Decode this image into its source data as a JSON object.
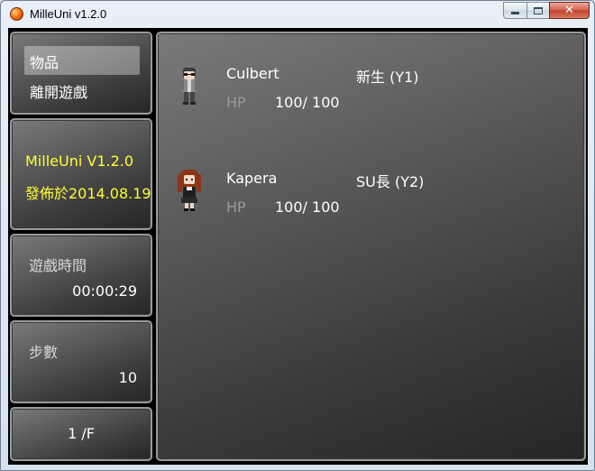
{
  "window": {
    "title": "MilleUni v1.2.0",
    "minimize_glyph": "minimize-icon",
    "maximize_glyph": "maximize-icon",
    "close_glyph": "✕"
  },
  "menu": {
    "items": [
      {
        "label": "物品",
        "selected": true
      },
      {
        "label": "離開遊戲",
        "selected": false
      }
    ]
  },
  "version_panel": {
    "line1": "MilleUni V1.2.0",
    "line2": "發佈於2014.08.19"
  },
  "playtime_panel": {
    "label": "遊戲時間",
    "value": "00:00:29"
  },
  "steps_panel": {
    "label": "步數",
    "value": "10"
  },
  "floor_panel": {
    "value": "1 /F"
  },
  "party": [
    {
      "name": "Culbert",
      "title": "新生 (Y1)",
      "hp_label": "HP",
      "hp": "100/ 100",
      "sprite": "boy-sprite"
    },
    {
      "name": "Kapera",
      "title": "SU長 (Y2)",
      "hp_label": "HP",
      "hp": "100/ 100",
      "sprite": "girl-sprite"
    }
  ],
  "colors": {
    "accent_yellow": "#ffff33",
    "hp_label_gray": "#9a9a9a",
    "text_white": "#ffffff"
  }
}
